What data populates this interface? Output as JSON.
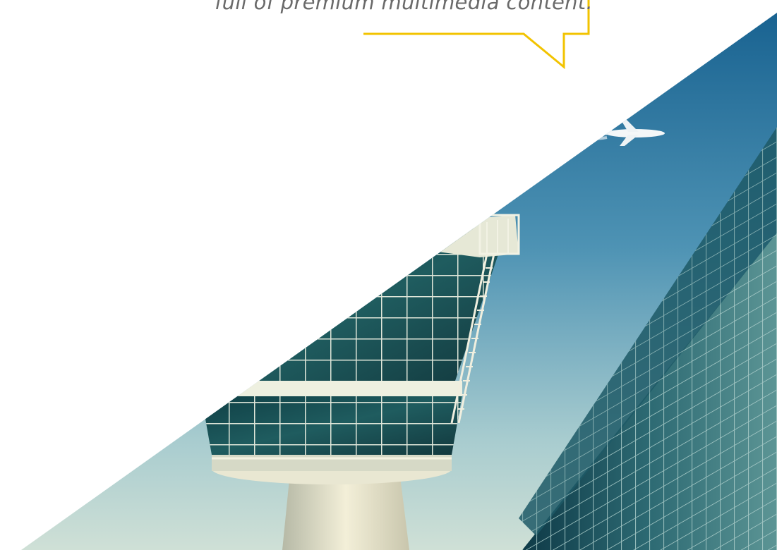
{
  "callout": {
    "text": "full of premium multimedia content.",
    "border_color": "#f2c300"
  },
  "photo": {
    "subject": "airport-control-tower",
    "sky_top": "#1f6e9e",
    "sky_bottom": "#b7d3d6"
  }
}
